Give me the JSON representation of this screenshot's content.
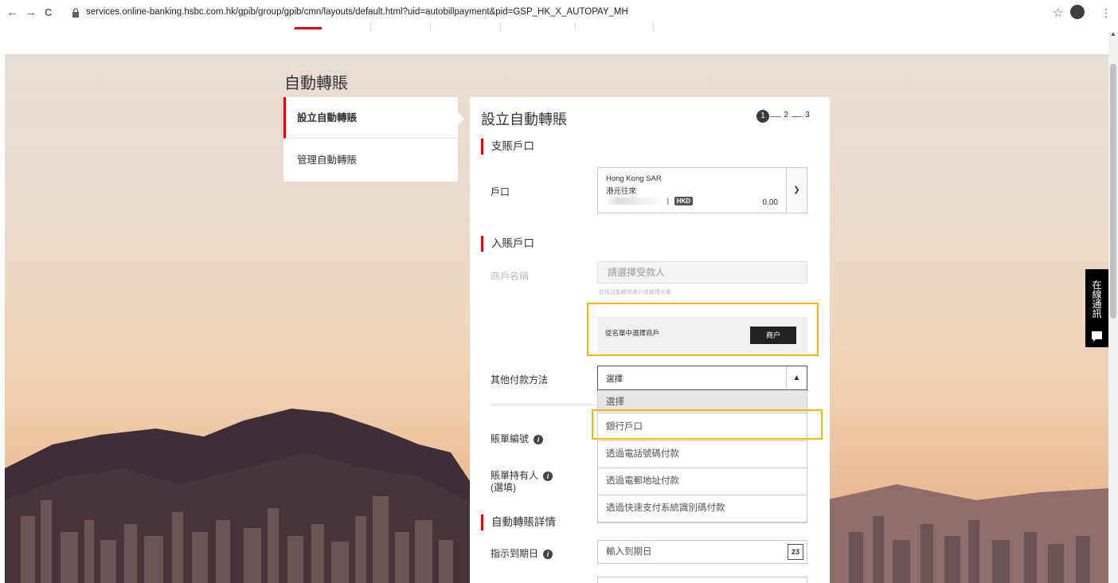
{
  "browser": {
    "back": "←",
    "forward": "→",
    "reload": "C",
    "url": "services.online-banking.hsbc.com.hk/gpib/group/gpib/cmn/layouts/default.html?uid=autobillpayment&pid=GSP_HK_X_AUTOPAY_MH",
    "star": "☆",
    "menu": "⋮"
  },
  "page": {
    "heading": "自動轉賬"
  },
  "sidebar": {
    "items": [
      {
        "label": "設立自動轉賬",
        "active": true
      },
      {
        "label": "管理自動轉賬",
        "active": false
      }
    ]
  },
  "panel": {
    "title": "設立自動轉賬",
    "steps": [
      "1",
      "2",
      "3"
    ],
    "debit_section": "支賬戶口",
    "account_label": "戶口",
    "account": {
      "region": "Hong Kong SAR",
      "type": "港元往來",
      "currency_badge": "HKD",
      "balance": "0.00"
    },
    "credit_section": "入賬戶口",
    "merchant_label": "商戶名稱",
    "merchant_placeholder": "請選擇受款人",
    "merchant_hint": "檢視自動轉賬商戶或機構名單",
    "merchant_pick_text": "從名單中選擇商戶",
    "merchant_button": "商户",
    "other_method_label": "其他付款方法",
    "other_method_value": "選擇",
    "dropdown_options": [
      "選擇",
      "銀行戶口",
      "透過電話號碼付款",
      "透過電郵地址付款",
      "透過快速支付系統識別碼付款"
    ],
    "bill_number_label": "賬單編號",
    "bill_holder_label_1": "賬單持有人",
    "bill_holder_label_2": "(選填)",
    "details_section": "自動轉賬詳情",
    "due_date_label": "指示到期日",
    "due_date_placeholder": "輸入到期日",
    "calendar_day": "23"
  },
  "chat": {
    "label_chars": [
      "在",
      "線",
      "通",
      "訊"
    ]
  },
  "colors": {
    "brand_red": "#db0011",
    "highlight": "#f5b700"
  }
}
